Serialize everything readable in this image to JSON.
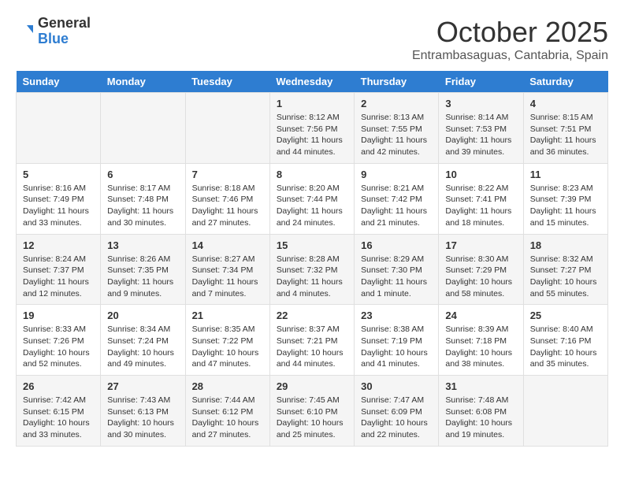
{
  "logo": {
    "text_general": "General",
    "text_blue": "Blue"
  },
  "header": {
    "month": "October 2025",
    "location": "Entrambasaguas, Cantabria, Spain"
  },
  "weekdays": [
    "Sunday",
    "Monday",
    "Tuesday",
    "Wednesday",
    "Thursday",
    "Friday",
    "Saturday"
  ],
  "weeks": [
    [
      {
        "day": "",
        "info": ""
      },
      {
        "day": "",
        "info": ""
      },
      {
        "day": "",
        "info": ""
      },
      {
        "day": "1",
        "info": "Sunrise: 8:12 AM\nSunset: 7:56 PM\nDaylight: 11 hours\nand 44 minutes."
      },
      {
        "day": "2",
        "info": "Sunrise: 8:13 AM\nSunset: 7:55 PM\nDaylight: 11 hours\nand 42 minutes."
      },
      {
        "day": "3",
        "info": "Sunrise: 8:14 AM\nSunset: 7:53 PM\nDaylight: 11 hours\nand 39 minutes."
      },
      {
        "day": "4",
        "info": "Sunrise: 8:15 AM\nSunset: 7:51 PM\nDaylight: 11 hours\nand 36 minutes."
      }
    ],
    [
      {
        "day": "5",
        "info": "Sunrise: 8:16 AM\nSunset: 7:49 PM\nDaylight: 11 hours\nand 33 minutes."
      },
      {
        "day": "6",
        "info": "Sunrise: 8:17 AM\nSunset: 7:48 PM\nDaylight: 11 hours\nand 30 minutes."
      },
      {
        "day": "7",
        "info": "Sunrise: 8:18 AM\nSunset: 7:46 PM\nDaylight: 11 hours\nand 27 minutes."
      },
      {
        "day": "8",
        "info": "Sunrise: 8:20 AM\nSunset: 7:44 PM\nDaylight: 11 hours\nand 24 minutes."
      },
      {
        "day": "9",
        "info": "Sunrise: 8:21 AM\nSunset: 7:42 PM\nDaylight: 11 hours\nand 21 minutes."
      },
      {
        "day": "10",
        "info": "Sunrise: 8:22 AM\nSunset: 7:41 PM\nDaylight: 11 hours\nand 18 minutes."
      },
      {
        "day": "11",
        "info": "Sunrise: 8:23 AM\nSunset: 7:39 PM\nDaylight: 11 hours\nand 15 minutes."
      }
    ],
    [
      {
        "day": "12",
        "info": "Sunrise: 8:24 AM\nSunset: 7:37 PM\nDaylight: 11 hours\nand 12 minutes."
      },
      {
        "day": "13",
        "info": "Sunrise: 8:26 AM\nSunset: 7:35 PM\nDaylight: 11 hours\nand 9 minutes."
      },
      {
        "day": "14",
        "info": "Sunrise: 8:27 AM\nSunset: 7:34 PM\nDaylight: 11 hours\nand 7 minutes."
      },
      {
        "day": "15",
        "info": "Sunrise: 8:28 AM\nSunset: 7:32 PM\nDaylight: 11 hours\nand 4 minutes."
      },
      {
        "day": "16",
        "info": "Sunrise: 8:29 AM\nSunset: 7:30 PM\nDaylight: 11 hours\nand 1 minute."
      },
      {
        "day": "17",
        "info": "Sunrise: 8:30 AM\nSunset: 7:29 PM\nDaylight: 10 hours\nand 58 minutes."
      },
      {
        "day": "18",
        "info": "Sunrise: 8:32 AM\nSunset: 7:27 PM\nDaylight: 10 hours\nand 55 minutes."
      }
    ],
    [
      {
        "day": "19",
        "info": "Sunrise: 8:33 AM\nSunset: 7:26 PM\nDaylight: 10 hours\nand 52 minutes."
      },
      {
        "day": "20",
        "info": "Sunrise: 8:34 AM\nSunset: 7:24 PM\nDaylight: 10 hours\nand 49 minutes."
      },
      {
        "day": "21",
        "info": "Sunrise: 8:35 AM\nSunset: 7:22 PM\nDaylight: 10 hours\nand 47 minutes."
      },
      {
        "day": "22",
        "info": "Sunrise: 8:37 AM\nSunset: 7:21 PM\nDaylight: 10 hours\nand 44 minutes."
      },
      {
        "day": "23",
        "info": "Sunrise: 8:38 AM\nSunset: 7:19 PM\nDaylight: 10 hours\nand 41 minutes."
      },
      {
        "day": "24",
        "info": "Sunrise: 8:39 AM\nSunset: 7:18 PM\nDaylight: 10 hours\nand 38 minutes."
      },
      {
        "day": "25",
        "info": "Sunrise: 8:40 AM\nSunset: 7:16 PM\nDaylight: 10 hours\nand 35 minutes."
      }
    ],
    [
      {
        "day": "26",
        "info": "Sunrise: 7:42 AM\nSunset: 6:15 PM\nDaylight: 10 hours\nand 33 minutes."
      },
      {
        "day": "27",
        "info": "Sunrise: 7:43 AM\nSunset: 6:13 PM\nDaylight: 10 hours\nand 30 minutes."
      },
      {
        "day": "28",
        "info": "Sunrise: 7:44 AM\nSunset: 6:12 PM\nDaylight: 10 hours\nand 27 minutes."
      },
      {
        "day": "29",
        "info": "Sunrise: 7:45 AM\nSunset: 6:10 PM\nDaylight: 10 hours\nand 25 minutes."
      },
      {
        "day": "30",
        "info": "Sunrise: 7:47 AM\nSunset: 6:09 PM\nDaylight: 10 hours\nand 22 minutes."
      },
      {
        "day": "31",
        "info": "Sunrise: 7:48 AM\nSunset: 6:08 PM\nDaylight: 10 hours\nand 19 minutes."
      },
      {
        "day": "",
        "info": ""
      }
    ]
  ]
}
